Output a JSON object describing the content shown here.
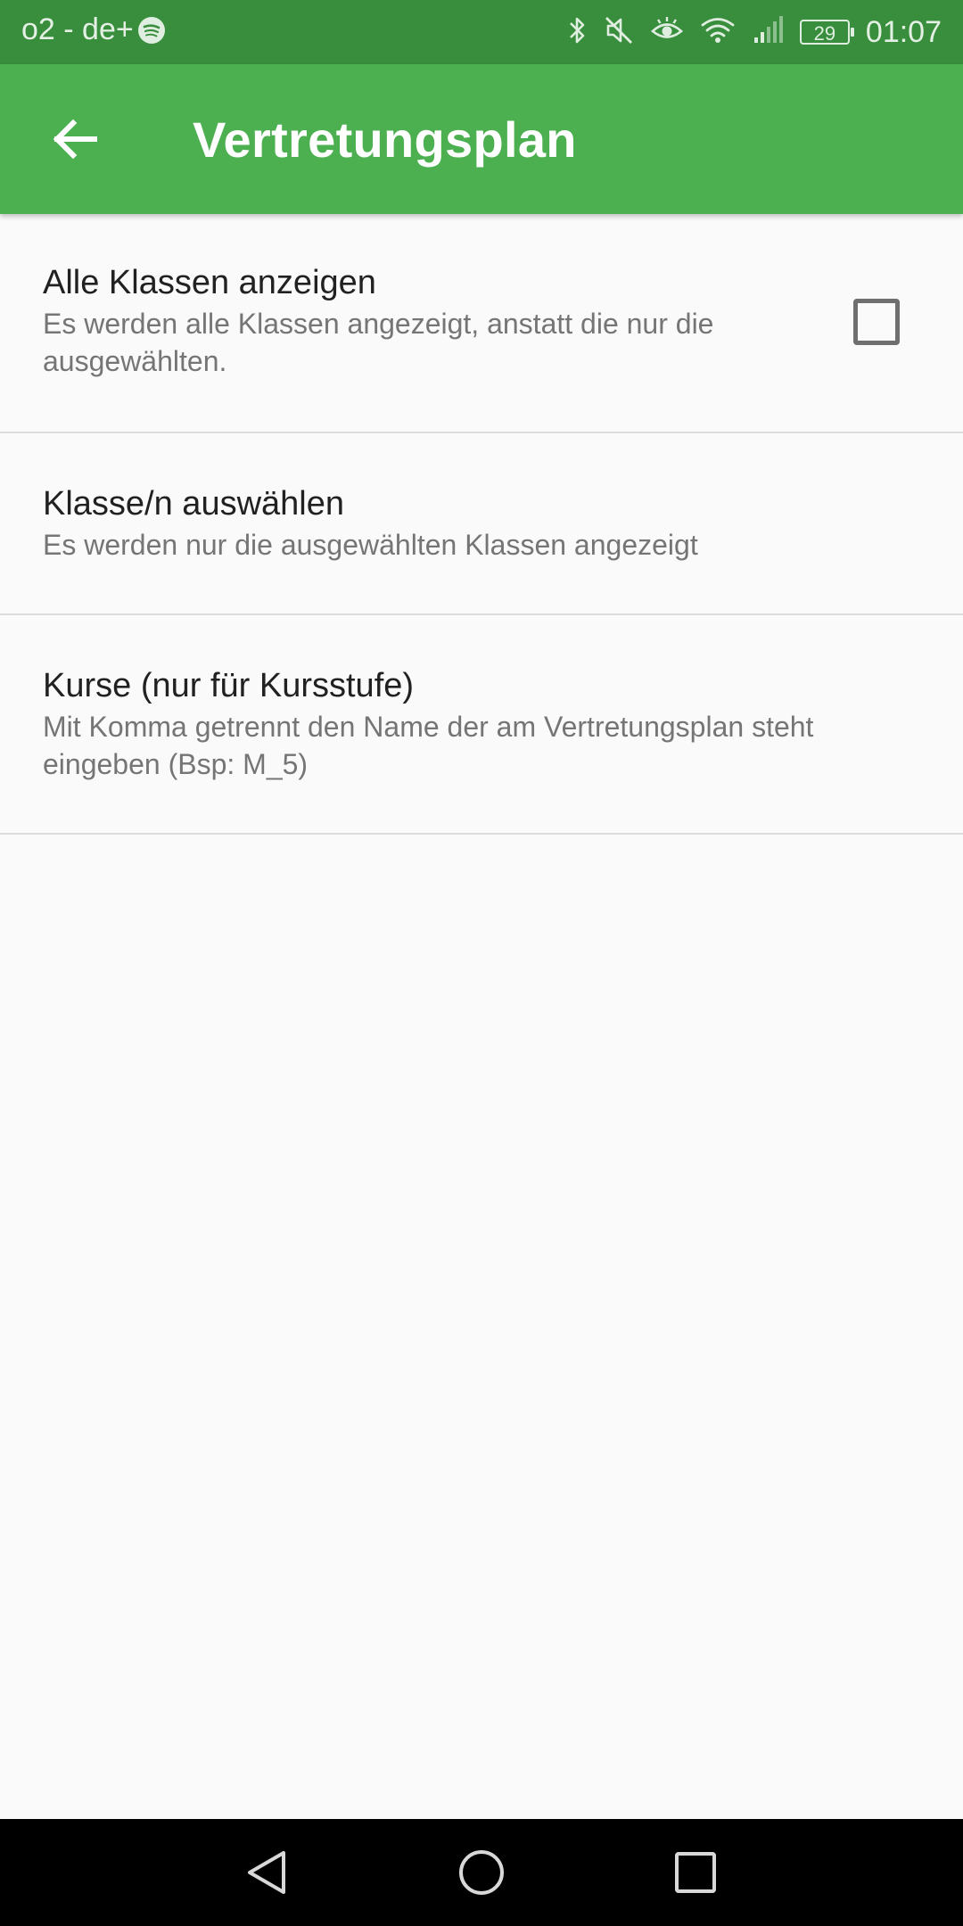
{
  "status_bar": {
    "carrier": "o2 - de+",
    "battery": "29",
    "time": "01:07",
    "icons": [
      "spotify-icon",
      "bluetooth-icon",
      "mute-icon",
      "eye-icon",
      "wifi-icon",
      "signal-icon",
      "battery-icon"
    ]
  },
  "app_bar": {
    "title": "Vertretungsplan",
    "back_icon": "arrow-back-icon",
    "color": "#4caf50",
    "status_color": "#388e3c"
  },
  "preferences": [
    {
      "title": "Alle Klassen anzeigen",
      "summary": "Es werden alle Klassen angezeigt, anstatt die nur die ausgewählten.",
      "checked": false
    },
    {
      "title": "Klasse/n auswählen",
      "summary": "Es werden nur die ausgewählten Klassen angezeigt"
    },
    {
      "title": "Kurse (nur für Kursstufe)",
      "summary": "Mit Komma getrennt den Name der am Vertretungsplan steht eingeben (Bsp: M_5)"
    }
  ],
  "nav_bar": {
    "icons": [
      "back-triangle-icon",
      "home-circle-icon",
      "recents-square-icon"
    ]
  }
}
